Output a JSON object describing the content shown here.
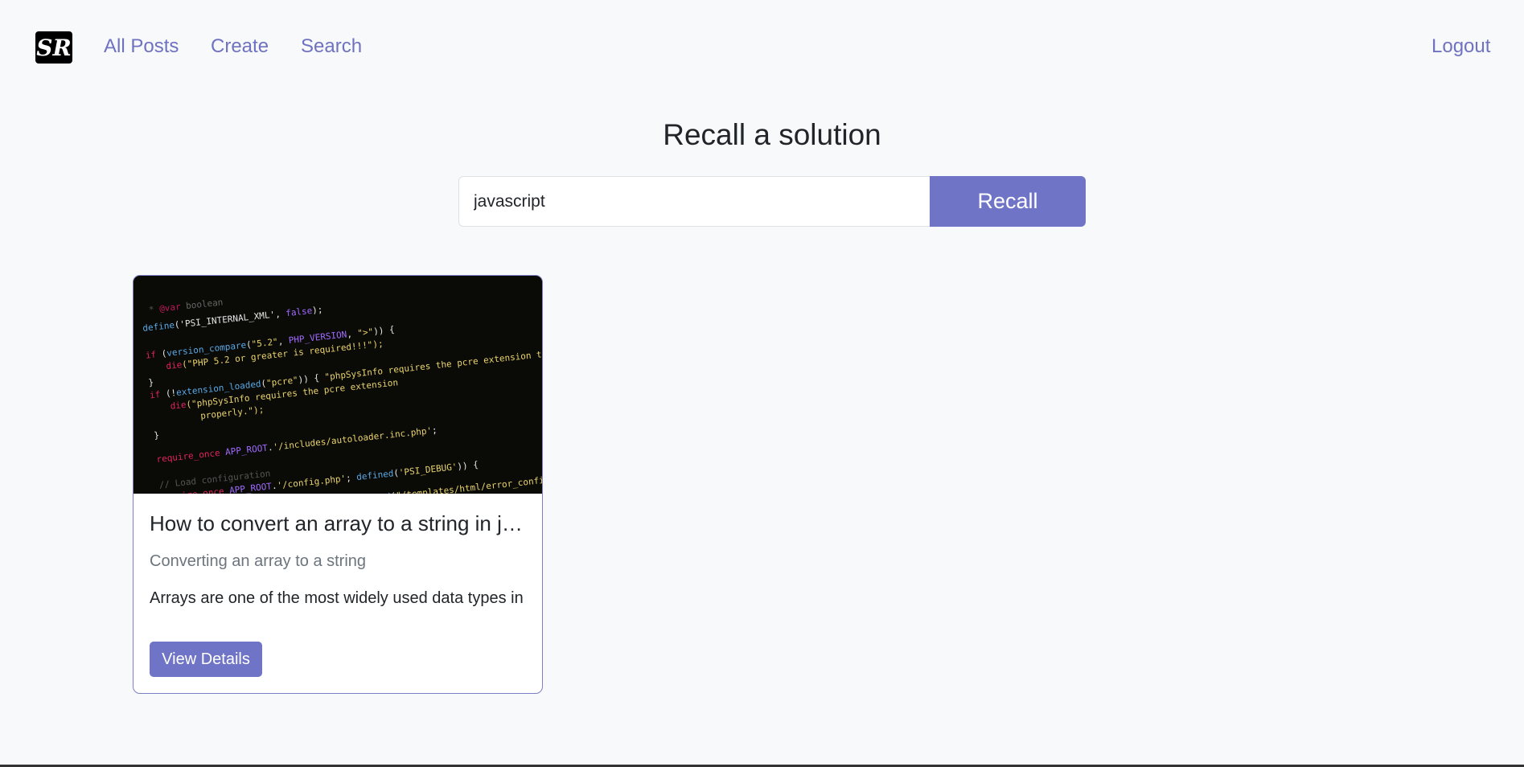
{
  "nav": {
    "logo_text": "SR",
    "links": [
      "All Posts",
      "Create",
      "Search"
    ],
    "logout": "Logout"
  },
  "main": {
    "title": "Recall a solution",
    "search": {
      "value": "javascript",
      "button": "Recall"
    }
  },
  "results": [
    {
      "title": "How to convert an array to a string in javascript",
      "subtitle": "Converting an array to a string",
      "excerpt": "Arrays are one of the most widely used data types in",
      "button": "View Details",
      "image": "code-screenshot"
    }
  ],
  "colors": {
    "accent": "#6f74c6",
    "link": "#6f72c0",
    "background": "#f8f9fa"
  }
}
